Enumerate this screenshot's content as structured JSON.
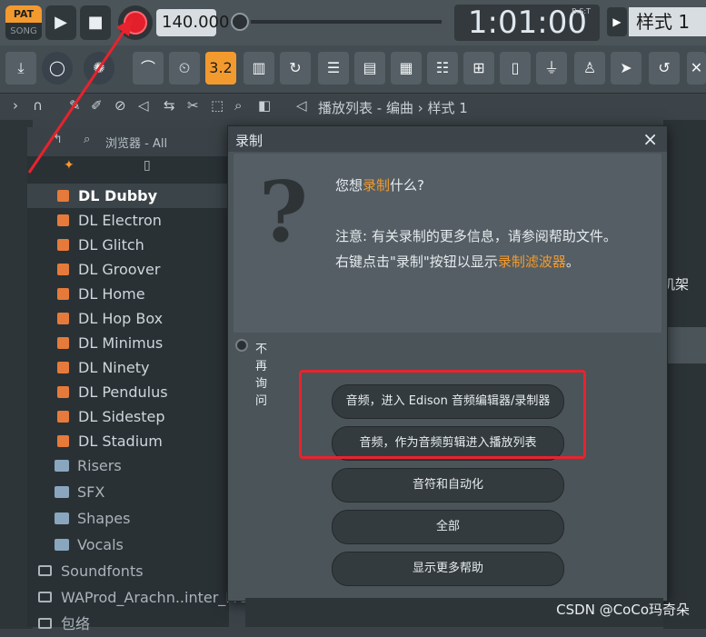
{
  "transport": {
    "pat_label": "PAT",
    "song_label": "SONG",
    "play_icon": "play-icon",
    "stop_icon": "stop-icon",
    "record_icon": "record-icon",
    "tempo_value": "140.000",
    "time_display": "1:01:00",
    "time_unit": "B:S:T",
    "pattern_name": "样式 1"
  },
  "breadcrumb": {
    "path": "播放列表 - 编曲 › 样式 1"
  },
  "browser": {
    "header_label": "浏览器 - All",
    "selected_item": "DL Dubby",
    "plugin_items": [
      "DL Electron",
      "DL Glitch",
      "DL Groover",
      "DL Home",
      "DL Hop Box",
      "DL Minimus",
      "DL Ninety",
      "DL Pendulus",
      "DL Sidestep",
      "DL Stadium"
    ],
    "folder_items": [
      "Risers",
      "SFX",
      "Shapes",
      "Vocals"
    ],
    "root_items": [
      "Soundfonts",
      "WAProd_Arachn..inter_Freebie",
      "包络"
    ]
  },
  "right_panel": {
    "label": "机架"
  },
  "dialog": {
    "title": "录制",
    "close_label": "×",
    "question_prefix": "您想",
    "question_highlight": "录制",
    "question_suffix": "什么?",
    "note_line1": "注意: 有关录制的更多信息，请参阅帮助文件。",
    "note_line2_prefix": "右键点击\"录制\"按钮以显示",
    "note_line2_highlight": "录制滤波器",
    "note_line2_suffix": "。",
    "dont_ask_label": "不再询问",
    "buttons": {
      "edison": "音频，进入 Edison 音频编辑器/录制器",
      "playlist": "音频，作为音频剪辑进入播放列表",
      "notes": "音符和自动化",
      "all": "全部",
      "help": "显示更多帮助"
    }
  },
  "watermark": "CSDN @CoCo玛奇朵",
  "colors": {
    "accent_orange": "#f39a2e",
    "record_red": "#e21f2a",
    "highlight_box": "#e8232d"
  }
}
